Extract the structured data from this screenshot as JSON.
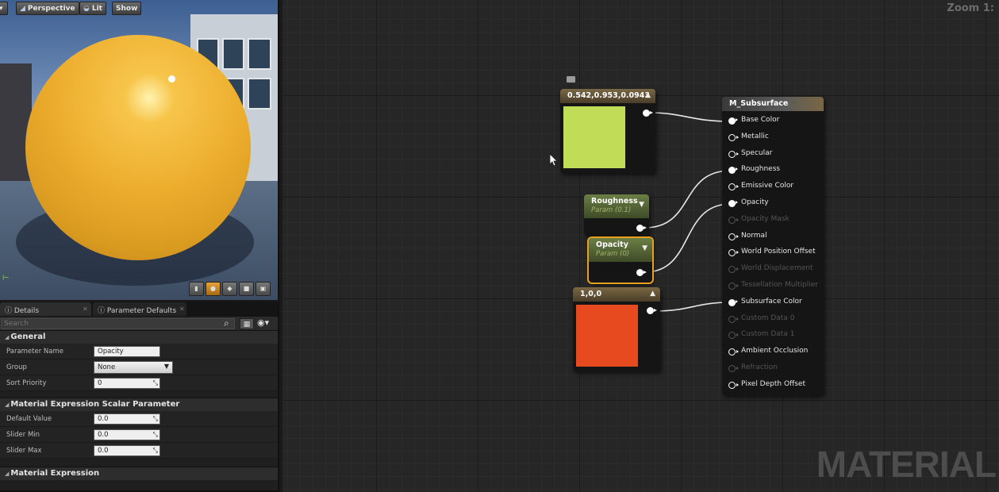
{
  "viewport": {
    "buttons": [
      {
        "label": "Perspective",
        "icon": "perspective-icon"
      },
      {
        "label": "Lit",
        "icon": "lit-icon"
      },
      {
        "label": "Show",
        "icon": ""
      }
    ],
    "tools": [
      "cylinder-icon",
      "sphere-icon",
      "plane-icon",
      "cube-icon",
      "mesh-icon"
    ],
    "active_tool": 1,
    "sphere_color": "#EDAE2E"
  },
  "details": {
    "tabs": [
      {
        "label": "Details",
        "active": true
      },
      {
        "label": "Parameter Defaults",
        "active": false
      }
    ],
    "search": {
      "placeholder": "Search"
    },
    "sections": {
      "general": "General",
      "scalar": "Material Expression Scalar Parameter",
      "expression": "Material Expression"
    },
    "general_props": [
      {
        "label": "Parameter Name",
        "value": "Opacity",
        "kind": "text"
      },
      {
        "label": "Group",
        "value": "None",
        "kind": "select"
      },
      {
        "label": "Sort Priority",
        "value": "0",
        "kind": "number"
      }
    ],
    "scalar_props": [
      {
        "label": "Default Value",
        "value": "0.0"
      },
      {
        "label": "Slider Min",
        "value": "0.0"
      },
      {
        "label": "Slider Max",
        "value": "0.0"
      }
    ]
  },
  "graph": {
    "zoom": "Zoom 1:",
    "watermark": "MATERIAL",
    "nodes": {
      "color_green": {
        "title": "0.542,0.953,0.0943",
        "swatch": "#C1DC57"
      },
      "roughness": {
        "title": "Roughness",
        "subtitle": "Param (0.1)"
      },
      "opacity": {
        "title": "Opacity",
        "subtitle": "Param (0)"
      },
      "color_red": {
        "title": "1,0,0",
        "swatch": "#E64A1E"
      }
    },
    "result": {
      "title": "M_Subsurface",
      "pins": [
        {
          "label": "Base Color",
          "state": "connected"
        },
        {
          "label": "Metallic",
          "state": "open"
        },
        {
          "label": "Specular",
          "state": "open"
        },
        {
          "label": "Roughness",
          "state": "connected"
        },
        {
          "label": "Emissive Color",
          "state": "open"
        },
        {
          "label": "Opacity",
          "state": "connected"
        },
        {
          "label": "Opacity Mask",
          "state": "disabled"
        },
        {
          "label": "Normal",
          "state": "open"
        },
        {
          "label": "World Position Offset",
          "state": "open"
        },
        {
          "label": "World Displacement",
          "state": "disabled"
        },
        {
          "label": "Tessellation Multiplier",
          "state": "disabled"
        },
        {
          "label": "Subsurface Color",
          "state": "connected"
        },
        {
          "label": "Custom Data 0",
          "state": "disabled"
        },
        {
          "label": "Custom Data 1",
          "state": "disabled"
        },
        {
          "label": "Ambient Occlusion",
          "state": "open"
        },
        {
          "label": "Refraction",
          "state": "disabled"
        },
        {
          "label": "Pixel Depth Offset",
          "state": "open"
        }
      ]
    }
  }
}
